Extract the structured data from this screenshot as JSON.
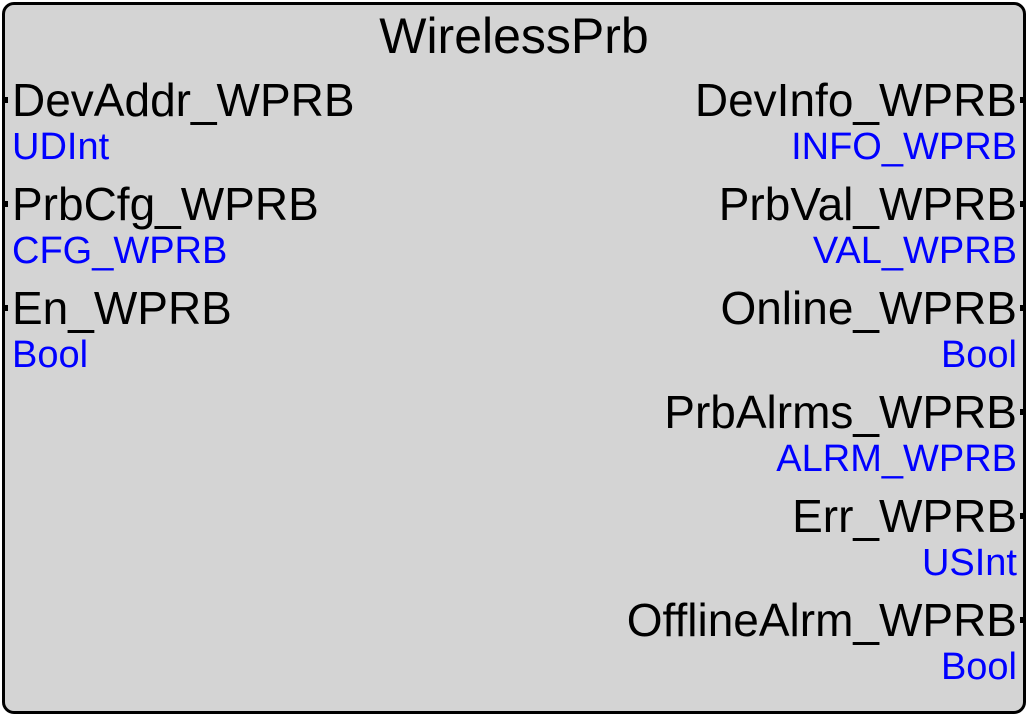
{
  "block": {
    "title": "WirelessPrb",
    "inputs": [
      {
        "name": "DevAddr_WPRB",
        "type": "UDInt"
      },
      {
        "name": "PrbCfg_WPRB",
        "type": "CFG_WPRB"
      },
      {
        "name": "En_WPRB",
        "type": "Bool"
      }
    ],
    "outputs": [
      {
        "name": "DevInfo_WPRB",
        "type": "INFO_WPRB"
      },
      {
        "name": "PrbVal_WPRB",
        "type": "VAL_WPRB"
      },
      {
        "name": "Online_WPRB",
        "type": "Bool"
      },
      {
        "name": "PrbAlrms_WPRB",
        "type": "ALRM_WPRB"
      },
      {
        "name": "Err_WPRB",
        "type": "USInt"
      },
      {
        "name": "OfflineAlrm_WPRB",
        "type": "Bool"
      }
    ]
  },
  "colors": {
    "background": "#d4d4d4",
    "border": "#000000",
    "pin_name": "#000000",
    "pin_type": "#0000ff"
  }
}
